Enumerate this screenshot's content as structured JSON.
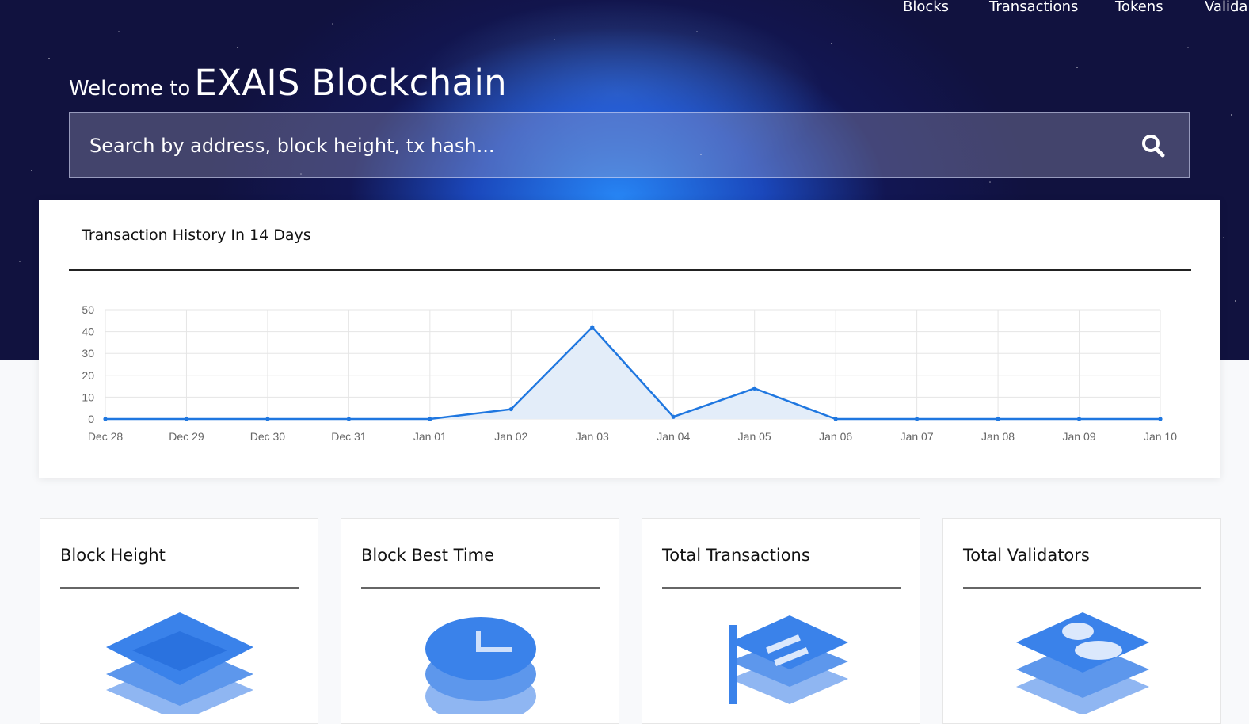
{
  "nav": {
    "items": [
      "Blocks",
      "Transactions",
      "Tokens",
      "Valida"
    ]
  },
  "hero": {
    "welcome_small": "Welcome to",
    "welcome_big": "EXAIS Blockchain"
  },
  "search": {
    "placeholder": "Search by address, block height, tx hash..."
  },
  "chart_card": {
    "title": "Transaction History In 14 Days"
  },
  "chart_data": {
    "type": "area",
    "categories": [
      "Dec 28",
      "Dec 29",
      "Dec 30",
      "Dec 31",
      "Jan 01",
      "Jan 02",
      "Jan 03",
      "Jan 04",
      "Jan 05",
      "Jan 06",
      "Jan 07",
      "Jan 08",
      "Jan 09",
      "Jan 10"
    ],
    "series": [
      {
        "values": [
          0,
          0,
          0,
          0,
          0,
          4.5,
          42,
          1,
          14,
          0,
          0,
          0,
          0,
          0
        ]
      }
    ],
    "ylim": [
      0,
      50
    ],
    "yticks": [
      0,
      10,
      20,
      30,
      40,
      50
    ],
    "grid": true,
    "line_color": "#1f77e0",
    "fill_color": "#e3edf9"
  },
  "stats": [
    {
      "title": "Block Height",
      "icon": "layers-icon"
    },
    {
      "title": "Block Best Time",
      "icon": "clock-icon"
    },
    {
      "title": "Total Transactions",
      "icon": "document-stack-icon"
    },
    {
      "title": "Total Validators",
      "icon": "user-stack-icon"
    }
  ],
  "colors": {
    "hero_bg": "#11123f",
    "accent_blue": "#2f7fe8"
  }
}
